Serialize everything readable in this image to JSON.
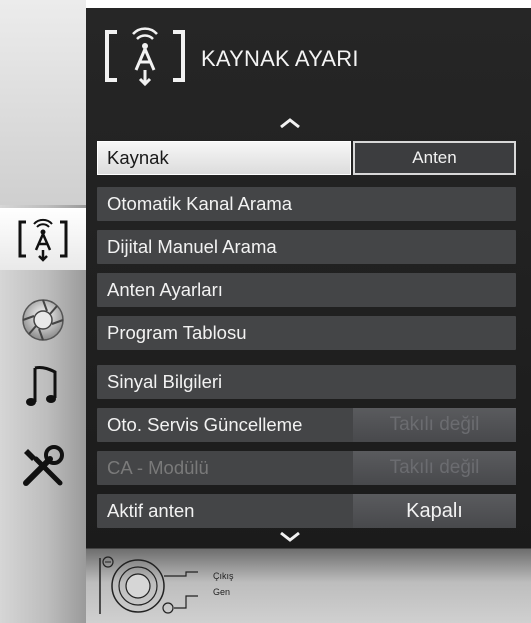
{
  "header": {
    "title": "KAYNAK AYARI"
  },
  "menu": [
    {
      "label": "Kaynak",
      "value": "Anten",
      "state": "selected"
    },
    {
      "label": "Otomatik Kanal Arama",
      "value": ""
    },
    {
      "label": "Dijital Manuel Arama",
      "value": ""
    },
    {
      "label": "Anten Ayarları",
      "value": ""
    },
    {
      "label": "Program Tablosu",
      "value": ""
    },
    {
      "label": "Sinyal Bilgileri",
      "value": ""
    },
    {
      "label": "Oto. Servis Güncelleme",
      "value": "Takılı değil",
      "state": "value-disabled"
    },
    {
      "label": "CA - Modülü",
      "value": "Takılı değil",
      "state": "disabled"
    },
    {
      "label": "Aktif anten",
      "value": "Kapalı"
    }
  ],
  "sidebar": {
    "icons": [
      "source-settings-icon",
      "picture-settings-icon",
      "sound-settings-icon",
      "tools-settings-icon"
    ],
    "selected": "source-settings-icon"
  },
  "footer": {
    "exit_label": "Çıkış",
    "back_label": "Gen"
  },
  "colors": {
    "panel": "#1f1f1f",
    "row": "#444547",
    "selected_row": "#efefef",
    "text": "#f2f2f2"
  }
}
